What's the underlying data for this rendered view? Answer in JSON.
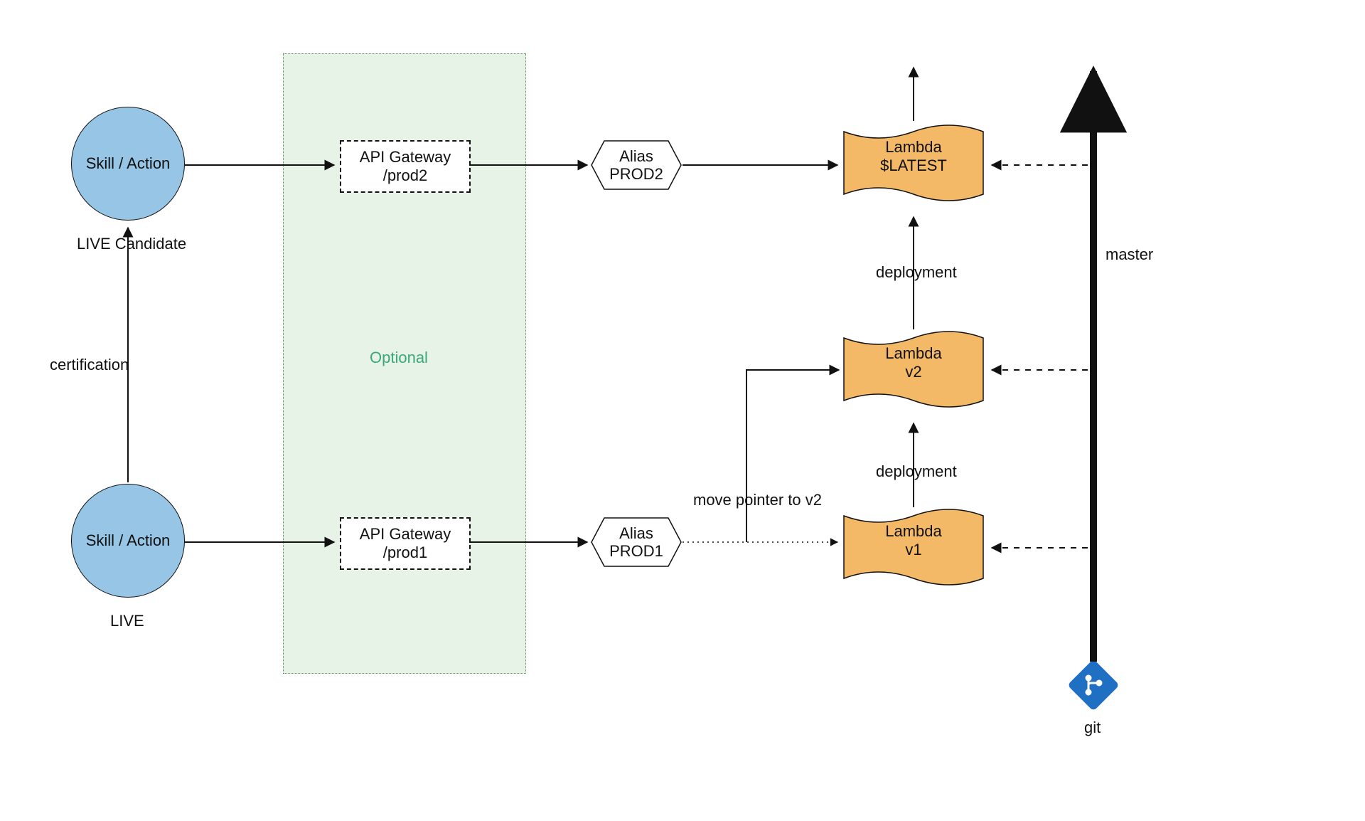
{
  "skill_top": {
    "label": "Skill / Action",
    "caption": "LIVE Candidate"
  },
  "skill_bottom": {
    "label": "Skill / Action",
    "caption": "LIVE"
  },
  "certification_label": "certification",
  "optional_label": "Optional",
  "api_top": {
    "title": "API Gateway",
    "path": "/prod2"
  },
  "api_bottom": {
    "title": "API Gateway",
    "path": "/prod1"
  },
  "alias_top": {
    "title": "Alias",
    "name": "PROD2"
  },
  "alias_bottom": {
    "title": "Alias",
    "name": "PROD1"
  },
  "move_pointer_label": "move pointer to v2",
  "lambda_latest": {
    "title": "Lambda",
    "version": "$LATEST"
  },
  "lambda_v2": {
    "title": "Lambda",
    "version": "v2"
  },
  "lambda_v1": {
    "title": "Lambda",
    "version": "v1"
  },
  "deployment_label_upper": "deployment",
  "deployment_label_lower": "deployment",
  "master_label": "master",
  "git_label": "git",
  "colors": {
    "circle_fill": "#97c5e6",
    "optional_fill": "#e7f3e6",
    "lambda_fill": "#f4b967",
    "git_fill": "#1f6fc3"
  }
}
